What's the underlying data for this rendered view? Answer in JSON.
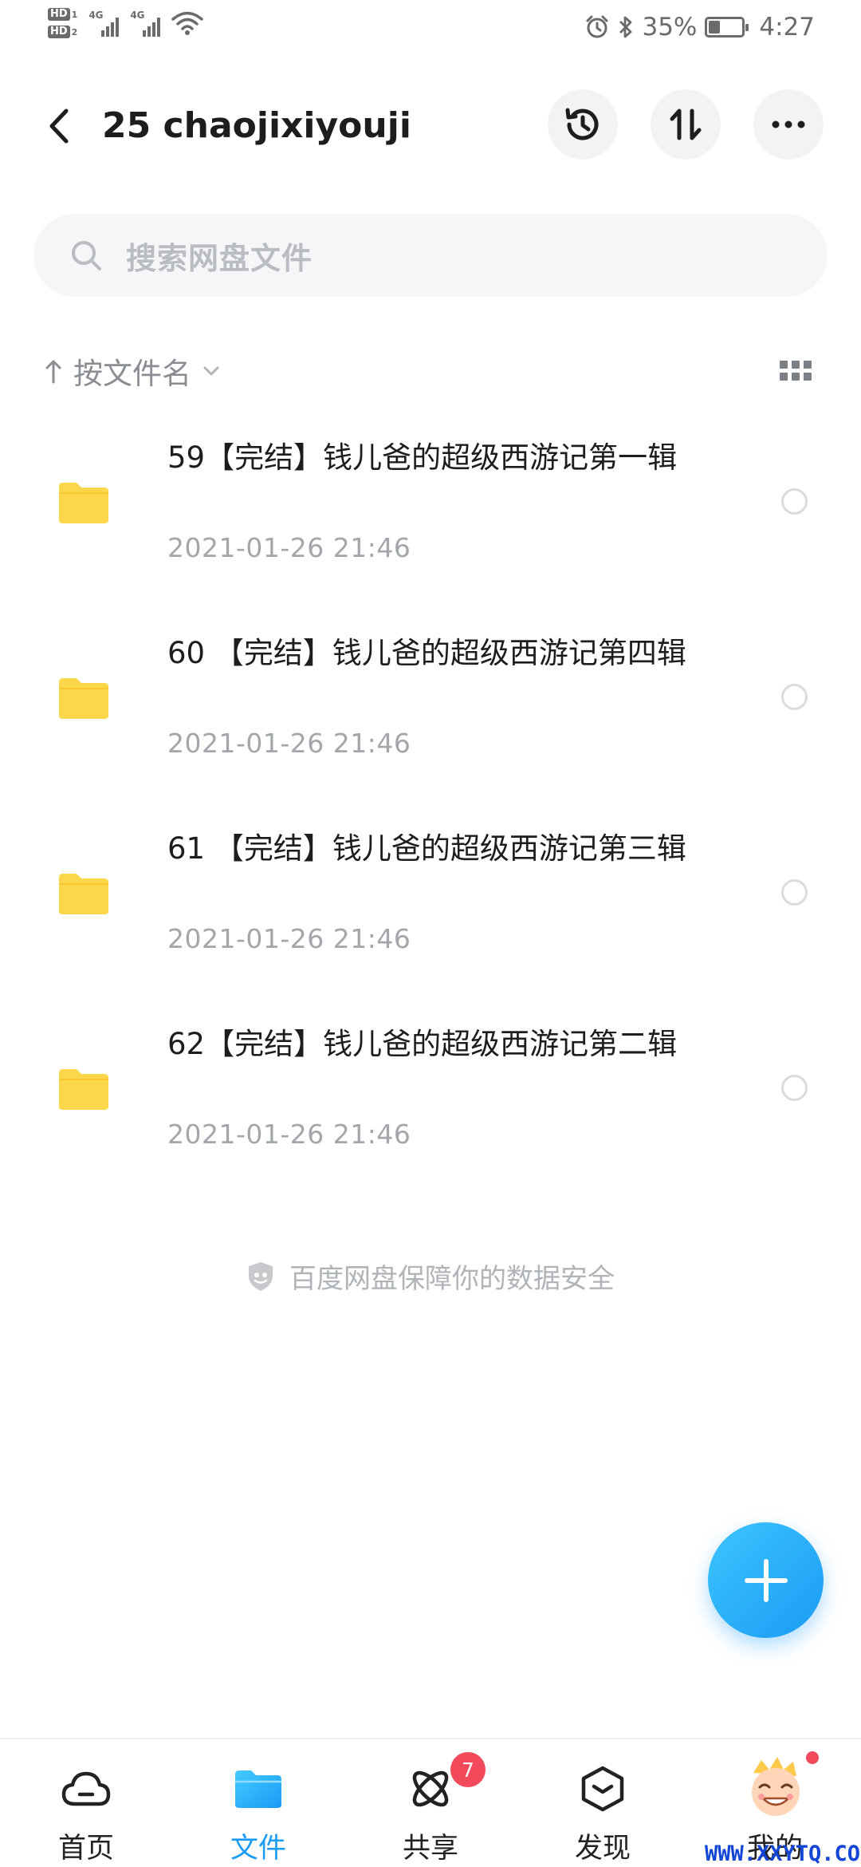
{
  "status_bar": {
    "hd1": "HD",
    "hd1_n": "1",
    "hd2": "HD",
    "hd2_n": "2",
    "net1": "4G",
    "net2": "4G",
    "battery": "35%",
    "battery_level": 0.35,
    "time": "4:27"
  },
  "header": {
    "title": "25 chaojixiyouji"
  },
  "search": {
    "placeholder": "搜索网盘文件"
  },
  "sort": {
    "label": "按文件名"
  },
  "files": [
    {
      "name": "59【完结】钱儿爸的超级西游记第一辑",
      "date": "2021-01-26  21:46"
    },
    {
      "name": "60 【完结】钱儿爸的超级西游记第四辑",
      "date": "2021-01-26  21:46"
    },
    {
      "name": "61 【完结】钱儿爸的超级西游记第三辑",
      "date": "2021-01-26  21:46"
    },
    {
      "name": "62【完结】钱儿爸的超级西游记第二辑",
      "date": "2021-01-26  21:46"
    }
  ],
  "safety_note": "百度网盘保障你的数据安全",
  "bottom_nav": {
    "items": [
      {
        "label": "首页"
      },
      {
        "label": "文件"
      },
      {
        "label": "共享"
      },
      {
        "label": "发现"
      },
      {
        "label": "我的"
      }
    ],
    "share_badge": "7",
    "active_color": "#1a9bf5"
  },
  "watermark": "WWW.XXYTQ.COM",
  "colors": {
    "folder": "#fdd74b",
    "accent": "#1a9bf5",
    "badge": "#f24a5b"
  }
}
